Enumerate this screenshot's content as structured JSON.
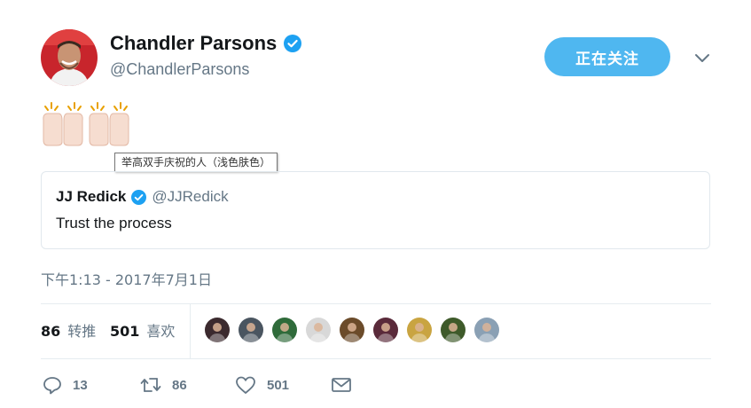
{
  "author": {
    "display_name": "Chandler Parsons",
    "handle": "@ChandlerParsons"
  },
  "follow_button": {
    "label": "正在关注"
  },
  "tweet": {
    "emoji": [
      "raising-hands-light-skin-tone",
      "raising-hands-light-skin-tone"
    ],
    "emoji_tooltip": "举高双手庆祝的人（浅色肤色）"
  },
  "quoted_tweet": {
    "display_name": "JJ Redick",
    "handle": "@JJRedick",
    "text": "Trust the process"
  },
  "timestamp": "下午1:13 - 2017年7月1日",
  "stats": {
    "retweets": {
      "count": "86",
      "label": "转推"
    },
    "likes": {
      "count": "501",
      "label": "喜欢"
    }
  },
  "likers": [
    {
      "color": "#3b2a2e"
    },
    {
      "color": "#4a5560"
    },
    {
      "color": "#2f6b3a"
    },
    {
      "color": "#d8d8d8"
    },
    {
      "color": "#6b4b2a"
    },
    {
      "color": "#5a2a3a"
    },
    {
      "color": "#c9a441"
    },
    {
      "color": "#3e5a2a"
    },
    {
      "color": "#8aa0b4"
    }
  ],
  "actions": {
    "reply_count": "13",
    "retweet_count": "86",
    "like_count": "501"
  },
  "colors": {
    "accent": "#1da1f2",
    "follow_button_bg": "#4fb7f0",
    "secondary_text": "#657786"
  }
}
